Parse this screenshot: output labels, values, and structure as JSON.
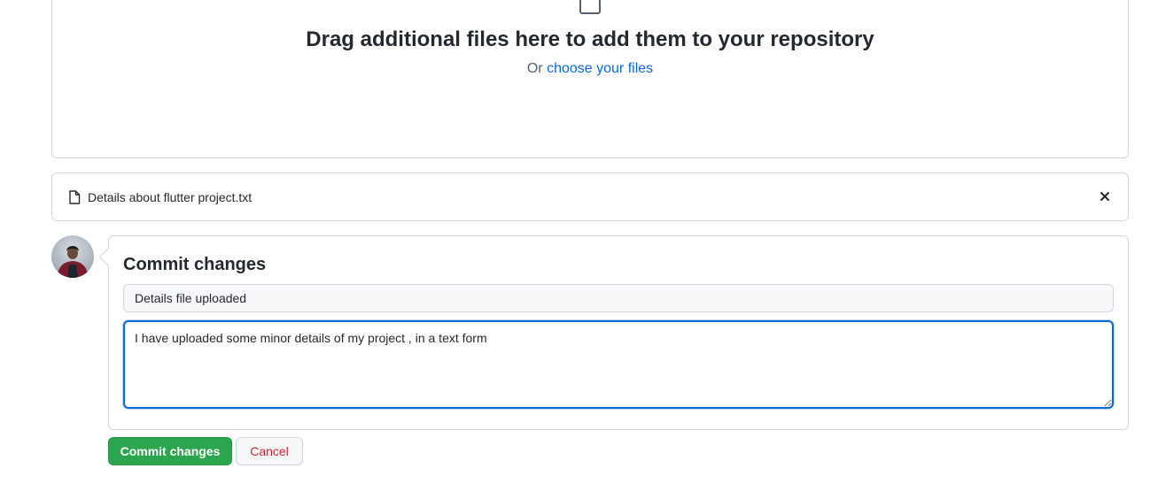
{
  "dropzone": {
    "title": "Drag additional files here to add them to your repository",
    "or_text": "Or",
    "choose_link": "choose your files"
  },
  "file": {
    "name": "Details about flutter project.txt",
    "icon": "file-icon",
    "remove_icon": "close-icon"
  },
  "commit": {
    "heading": "Commit changes",
    "summary_value": "Details file uploaded",
    "description_value": "I have uploaded some minor details of my project , in a text form",
    "commit_button": "Commit changes",
    "cancel_button": "Cancel"
  },
  "colors": {
    "primary_button": "#2da44e",
    "link": "#0969da",
    "cancel_text": "#cf222e",
    "focus_border": "#0969da",
    "border": "#d0d7de"
  }
}
